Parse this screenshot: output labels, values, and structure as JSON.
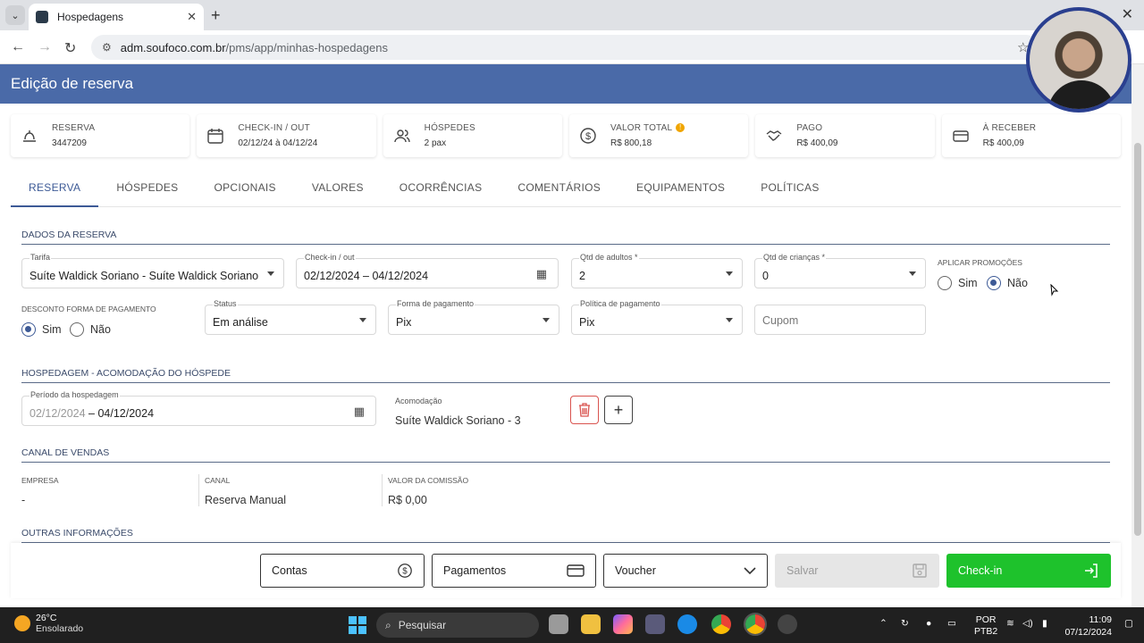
{
  "browser": {
    "tab_title": "Hospedagens",
    "url_domain": "adm.soufoco.com.br",
    "url_path": "/pms/app/minhas-hospedagens"
  },
  "header": {
    "title": "Edição de reserva"
  },
  "cards": [
    {
      "label": "RESERVA",
      "value": "3447209",
      "icon": "bell-icon"
    },
    {
      "label": "CHECK-IN / OUT",
      "value": "02/12/24 à 04/12/24",
      "icon": "calendar-icon"
    },
    {
      "label": "HÓSPEDES",
      "value": "2 pax",
      "icon": "people-icon"
    },
    {
      "label": "VALOR TOTAL",
      "value": "R$ 800,18",
      "icon": "dollar-icon"
    },
    {
      "label": "PAGO",
      "value": "R$ 400,09",
      "icon": "handshake-icon"
    },
    {
      "label": "À RECEBER",
      "value": "R$ 400,09",
      "icon": "card-icon"
    }
  ],
  "tabs": [
    "RESERVA",
    "HÓSPEDES",
    "OPCIONAIS",
    "VALORES",
    "OCORRÊNCIAS",
    "COMENTÁRIOS",
    "EQUIPAMENTOS",
    "POLÍTICAS"
  ],
  "dados": {
    "section": "DADOS DA RESERVA",
    "tarifa_label": "Tarifa",
    "tarifa_value": "Suíte Waldick Soriano - Suíte Waldick Soriano",
    "checkin_label": "Check-in / out",
    "checkin_value": "02/12/2024 – 04/12/2024",
    "adultos_label": "Qtd de adultos *",
    "adultos_value": "2",
    "criancas_label": "Qtd de crianças *",
    "criancas_value": "0",
    "promo_label": "APLICAR PROMOÇÕES",
    "promo_sim": "Sim",
    "promo_nao": "Não",
    "desconto_label": "DESCONTO FORMA DE PAGAMENTO",
    "desconto_sim": "Sim",
    "desconto_nao": "Não",
    "status_label": "Status",
    "status_value": "Em análise",
    "forma_label": "Forma de pagamento",
    "forma_value": "Pix",
    "politica_label": "Política de pagamento",
    "politica_value": "Pix",
    "cupom_placeholder": "Cupom"
  },
  "hospedagem": {
    "section": "HOSPEDAGEM - ACOMODAÇÃO DO HÓSPEDE",
    "periodo_label": "Período da hospedagem",
    "periodo_start": "02/12/2024",
    "periodo_end": "– 04/12/2024",
    "acomodacao_label": "Acomodação",
    "acomodacao_value": "Suíte Waldick Soriano - 3"
  },
  "canal": {
    "section": "CANAL DE VENDAS",
    "empresa_label": "EMPRESA",
    "empresa_value": "-",
    "canal_label": "CANAL",
    "canal_value": "Reserva Manual",
    "comissao_label": "VALOR DA COMISSÃO",
    "comissao_value": "R$ 0,00"
  },
  "outras": {
    "section": "OUTRAS INFORMAÇÕES"
  },
  "bottom": {
    "contas": "Contas",
    "pagamentos": "Pagamentos",
    "voucher": "Voucher",
    "salvar": "Salvar",
    "checkin": "Check-in"
  },
  "taskbar": {
    "temp": "26°C",
    "weather": "Ensolarado",
    "search": "Pesquisar",
    "lang1": "POR",
    "lang2": "PTB2",
    "time": "11:09",
    "date": "07/12/2024"
  },
  "colors": {
    "header_bg": "#4a6aa8",
    "accent": "#3d5a96",
    "checkin_green": "#1ec22c",
    "delete_red": "#d9534f"
  }
}
